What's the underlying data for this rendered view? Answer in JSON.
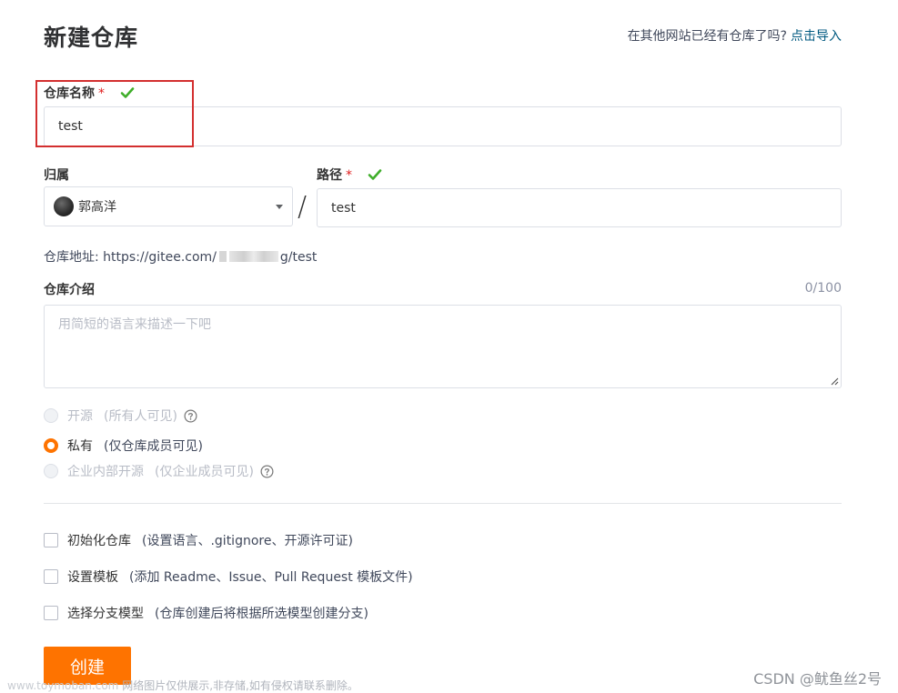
{
  "header": {
    "title": "新建仓库",
    "import_prompt": "在其他网站已经有仓库了吗?",
    "import_link": "点击导入"
  },
  "repo_name": {
    "label": "仓库名称",
    "required_mark": "*",
    "value": "test",
    "valid_icon": "check-icon"
  },
  "owner": {
    "label": "归属",
    "selected": "郭高洋",
    "avatar_icon": "avatar"
  },
  "separator": "/",
  "path": {
    "label": "路径",
    "required_mark": "*",
    "value": "test",
    "valid_icon": "check-icon"
  },
  "address": {
    "prefix": "仓库地址:",
    "url_start": "https://gitee.com/",
    "url_end": "g/test"
  },
  "description": {
    "label": "仓库介绍",
    "counter": "0/100",
    "placeholder": "用简短的语言来描述一下吧"
  },
  "visibility": {
    "options": [
      {
        "label": "开源",
        "hint": "(所有人可见)",
        "selected": false,
        "disabled": true,
        "has_help": true
      },
      {
        "label": "私有",
        "hint": "(仅仓库成员可见)",
        "selected": true,
        "disabled": false,
        "has_help": false
      },
      {
        "label": "企业内部开源",
        "hint": "(仅企业成员可见)",
        "selected": false,
        "disabled": true,
        "has_help": true
      }
    ]
  },
  "options": {
    "items": [
      {
        "label": "初始化仓库",
        "hint": "(设置语言、.gitignore、开源许可证)",
        "checked": false
      },
      {
        "label": "设置模板",
        "hint": "(添加 Readme、Issue、Pull Request 模板文件)",
        "checked": false
      },
      {
        "label": "选择分支模型",
        "hint": "(仓库创建后将根据所选模型创建分支)",
        "checked": false
      }
    ]
  },
  "actions": {
    "create_label": "创建"
  },
  "watermarks": {
    "left_url": "www.toymoban.com",
    "left_text": "网络图片仅供展示,非存储,如有侵权请联系删除。",
    "right_text": "CSDN @鱿鱼丝2号"
  },
  "colors": {
    "accent": "#fe7300",
    "link": "#005980",
    "success": "#3fae2a",
    "required": "#e02020",
    "highlight_border": "#d32f2f"
  }
}
